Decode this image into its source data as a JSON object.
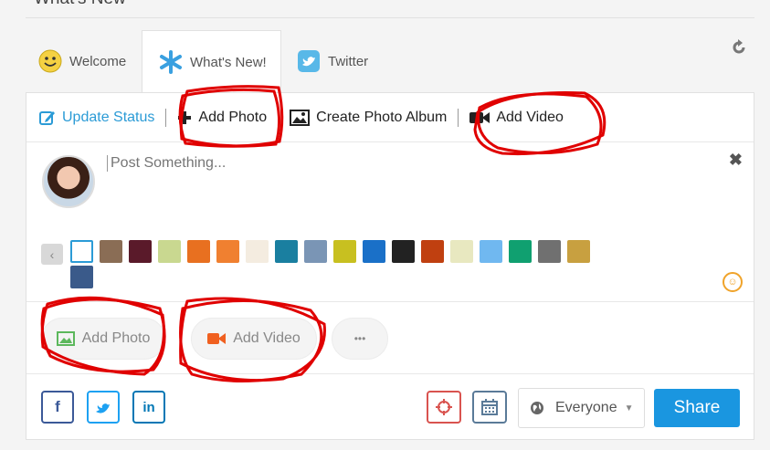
{
  "header": {
    "title": "What's New"
  },
  "tabs": [
    {
      "label": "Welcome",
      "icon": "smiley-icon"
    },
    {
      "label": "What's New!",
      "icon": "asterisk-icon"
    },
    {
      "label": "Twitter",
      "icon": "twitter-bird-icon"
    }
  ],
  "actions": {
    "update_status": "Update Status",
    "add_photo": "Add Photo",
    "create_album": "Create Photo Album",
    "add_video": "Add Video"
  },
  "compose": {
    "placeholder": "Post Something..."
  },
  "attach": {
    "add_photo": "Add Photo",
    "add_video": "Add Video",
    "more": "•••"
  },
  "footer": {
    "social": [
      "f",
      "t",
      "in"
    ],
    "privacy": "Everyone",
    "share": "Share"
  },
  "colors": {
    "accent": "#1a96e0",
    "link": "#2b9bd6",
    "annotation": "#e00000",
    "video_orange": "#f06020",
    "photo_green": "#5cb85c"
  },
  "swatch_colors": [
    "#ffffff",
    "#8a6d55",
    "#5a1a2a",
    "#c9d890",
    "#e87020",
    "#f08030",
    "#f4ece0",
    "#1a7fa0",
    "#7a95b5",
    "#c8c020",
    "#1a70c8",
    "#222222",
    "#c04010",
    "#e8e8c0",
    "#70b8f0",
    "#10a070",
    "#707070",
    "#c8a040",
    "#3a5a8a"
  ]
}
